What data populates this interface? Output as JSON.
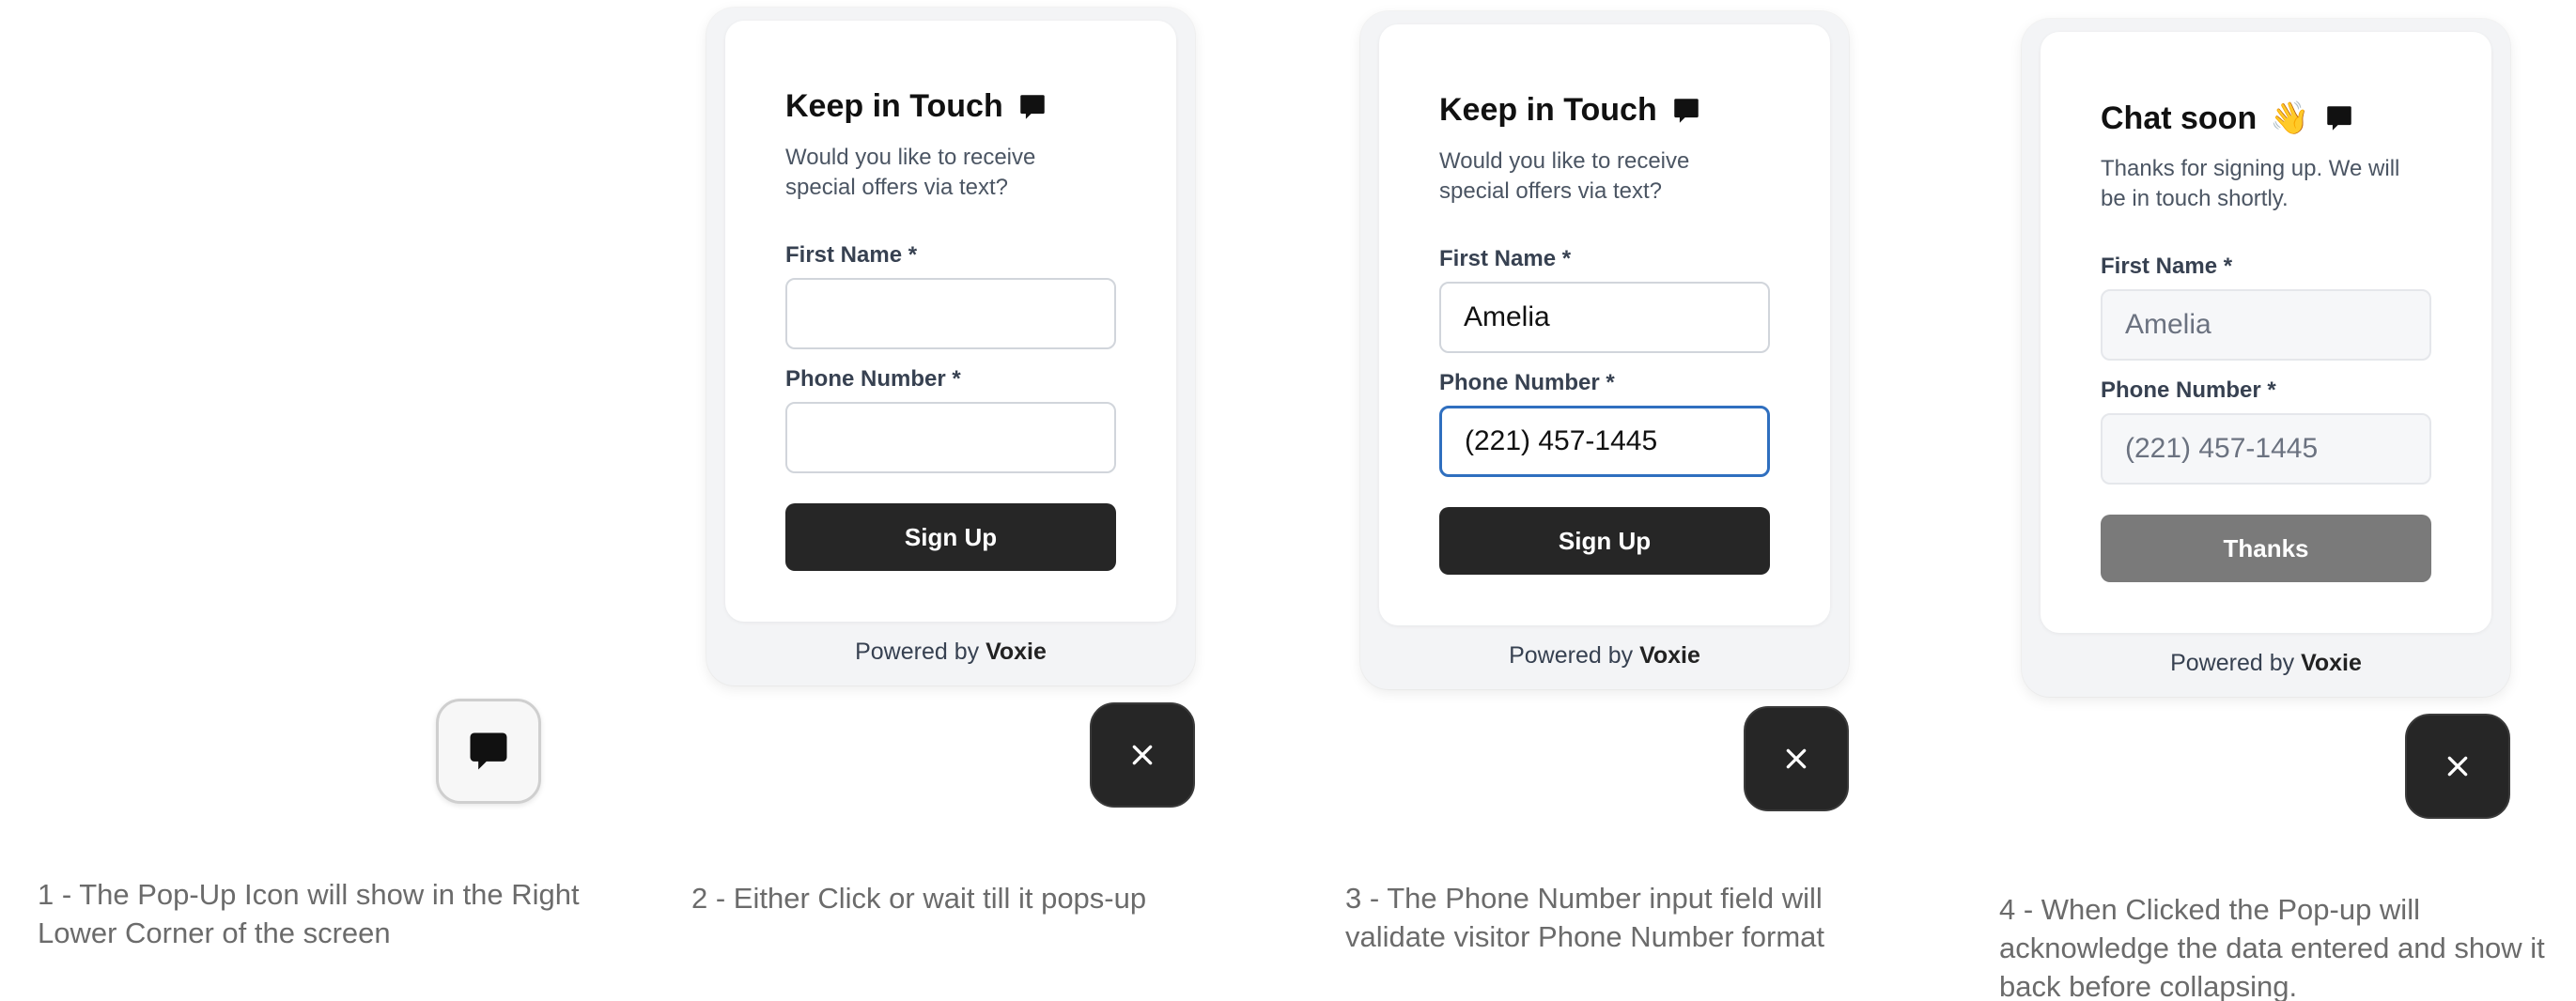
{
  "step1": {
    "caption": "1 - The Pop-Up Icon will show in the Right Lower Corner of the screen"
  },
  "step2": {
    "title": "Keep in Touch",
    "subtitle": "Would you like to receive special offers via text?",
    "first_name_label": "First Name *",
    "first_name_value": "",
    "phone_label": "Phone Number *",
    "phone_value": "",
    "button_label": "Sign Up",
    "powered_prefix": "Powered by",
    "powered_brand": "Voxie",
    "caption": "2 - Either Click or wait till it pops-up"
  },
  "step3": {
    "title": "Keep in Touch",
    "subtitle": "Would you like to receive special offers via text?",
    "first_name_label": "First Name *",
    "first_name_value": "Amelia",
    "phone_label": "Phone Number *",
    "phone_value": "(221) 457-1445",
    "button_label": "Sign Up",
    "powered_prefix": "Powered by",
    "powered_brand": "Voxie",
    "caption": "3 - The Phone Number input field will validate visitor Phone Number format"
  },
  "step4": {
    "title": "Chat soon",
    "title_emoji": "👋",
    "subtitle": "Thanks for signing up. We will be in touch shortly.",
    "first_name_label": "First Name *",
    "first_name_value": "Amelia",
    "phone_label": "Phone Number *",
    "phone_value": "(221) 457-1445",
    "button_label": "Thanks",
    "powered_prefix": "Powered by",
    "powered_brand": "Voxie",
    "caption": "4 - When Clicked the Pop-up will acknowledge the data entered and show it back before collapsing."
  },
  "icons": {
    "chat": "chat-bubble-icon",
    "close": "close-icon"
  },
  "colors": {
    "button_dark": "#262626",
    "button_thanks": "#7a7a7a",
    "focus_border": "#2f6fbf",
    "widget_bg": "#f3f4f6"
  }
}
